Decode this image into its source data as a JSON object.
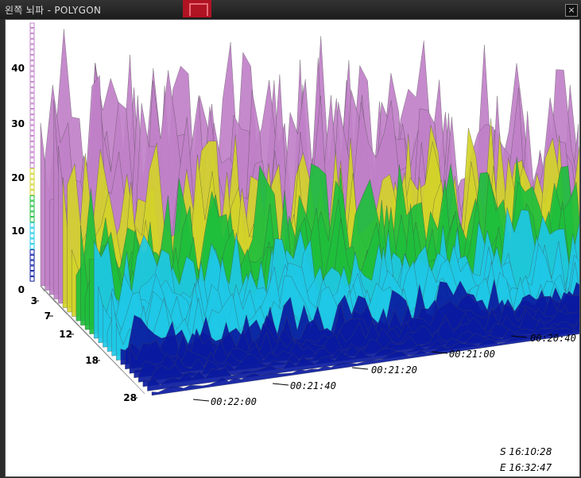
{
  "window": {
    "title": "왼쪽 뇌파 - POLYGON",
    "close_glyph": "×"
  },
  "chart_data": {
    "type": "surface3d",
    "y_axis_ticks": [
      "40",
      "30",
      "20",
      "10",
      "0"
    ],
    "depth_ticks": [
      "3",
      "7",
      "12",
      "18",
      "28"
    ],
    "time_ticks": [
      "00:20:40",
      "00:21:00",
      "00:21:20",
      "00:21:40",
      "00:22:00"
    ],
    "start_label": "S 16:10:28",
    "end_label": "E 16:32:47",
    "colors": {
      "low": "#0a1aa0",
      "mid": "#1ec8e6",
      "green": "#1ebe3c",
      "yellow": "#d2d22a",
      "high": "#c080c8"
    }
  }
}
